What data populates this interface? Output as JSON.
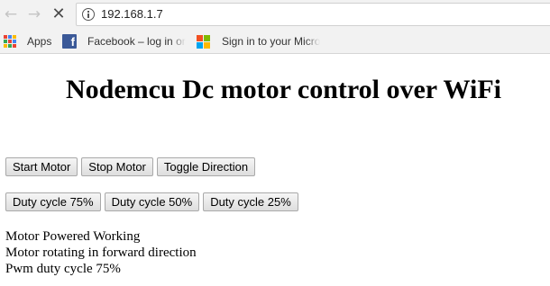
{
  "browser": {
    "url": "192.168.1.7",
    "nav": {
      "back_icon": "←",
      "forward_icon": "→",
      "reload_icon": "✕"
    },
    "bookmarks": [
      {
        "label": "Apps",
        "icon": "apps-grid-icon"
      },
      {
        "label": "Facebook – log in or",
        "icon": "facebook-icon"
      },
      {
        "label": "Sign in to your Micro",
        "icon": "microsoft-icon"
      }
    ]
  },
  "page": {
    "title": "Nodemcu Dc motor control over WiFi",
    "motor_buttons": [
      "Start Motor",
      "Stop Motor",
      "Toggle Direction"
    ],
    "duty_buttons": [
      "Duty cycle 75%",
      "Duty cycle 50%",
      "Duty cycle 25%"
    ],
    "status": [
      "Motor Powered Working",
      "Motor rotating in forward direction",
      "Pwm duty cycle 75%"
    ]
  },
  "colors": {
    "apps_grid": [
      "#ea4335",
      "#4285f4",
      "#fbbc05",
      "#34a853",
      "#ea4335",
      "#4285f4",
      "#fbbc05",
      "#34a853",
      "#ea4335"
    ],
    "facebook": "#3b5998",
    "microsoft": [
      "#f25022",
      "#7fba00",
      "#00a4ef",
      "#ffb900"
    ]
  }
}
